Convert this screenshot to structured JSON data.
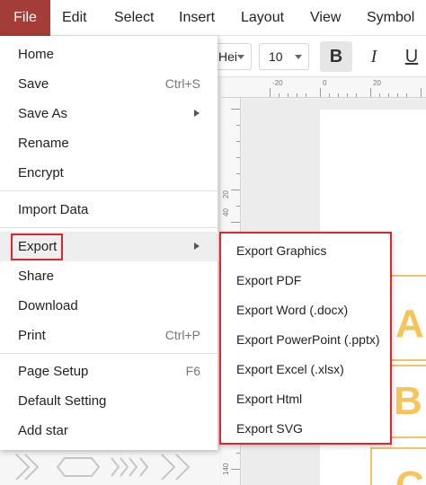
{
  "menubar": {
    "items": [
      "File",
      "Edit",
      "Select",
      "Insert",
      "Layout",
      "View",
      "Symbol"
    ]
  },
  "toolbar": {
    "font_name": "Hei",
    "font_size": "10",
    "bold_label": "B",
    "italic_label": "I",
    "underline_label": "U"
  },
  "ruler": {
    "top_labels": [
      "-20",
      "0",
      "20"
    ],
    "left_labels": [
      "20",
      "40",
      "140"
    ]
  },
  "canvas": {
    "letters": [
      "A",
      "B",
      "C"
    ]
  },
  "file_menu": {
    "home": "Home",
    "save": "Save",
    "save_shortcut": "Ctrl+S",
    "save_as": "Save As",
    "rename": "Rename",
    "encrypt": "Encrypt",
    "import_data": "Import Data",
    "export": "Export",
    "share": "Share",
    "download": "Download",
    "print": "Print",
    "print_shortcut": "Ctrl+P",
    "page_setup": "Page Setup",
    "page_setup_shortcut": "F6",
    "default_setting": "Default Setting",
    "add_star": "Add star"
  },
  "export_submenu": {
    "items": [
      "Export Graphics",
      "Export PDF",
      "Export Word (.docx)",
      "Export PowerPoint (.pptx)",
      "Export Excel (.xlsx)",
      "Export Html",
      "Export SVG"
    ]
  },
  "colors": {
    "file_tab_bg": "#a43c37",
    "highlight_border": "#d62a2f",
    "canvas_letter": "#f5c45a"
  }
}
